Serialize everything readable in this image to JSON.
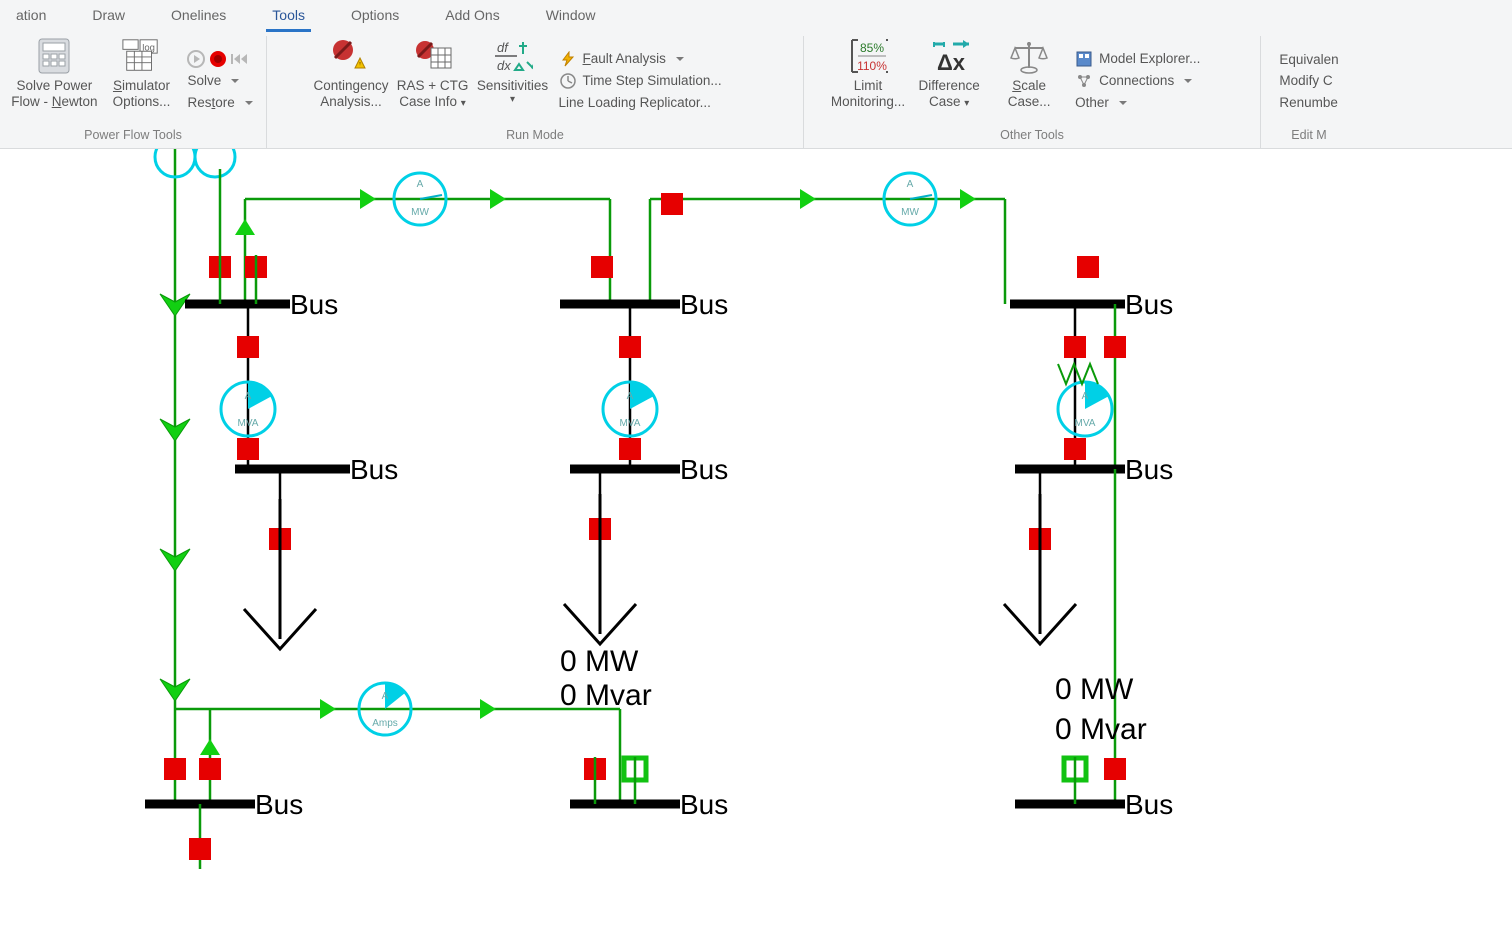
{
  "tabs": {
    "t0": "ation",
    "t1": "Draw",
    "t2": "Onelines",
    "t3": "Tools",
    "t4": "Options",
    "t5": "Add Ons",
    "t6": "Window"
  },
  "groups": {
    "pft": {
      "title": "Power Flow Tools",
      "solve_power_flow": "Solve Power\nFlow - Newton",
      "sim_options": "Simulator\nOptions...",
      "solve": "Solve",
      "restore": "Restore"
    },
    "run": {
      "title": "Run Mode",
      "contingency": "Contingency\nAnalysis...",
      "ras": "RAS + CTG\nCase Info",
      "sensitivities": "Sensitivities",
      "fault": "Fault Analysis",
      "tss": "Time Step Simulation...",
      "llr": "Line Loading Replicator..."
    },
    "other": {
      "title": "Other Tools",
      "limit": "Limit\nMonitoring...",
      "diff": "Difference\nCase",
      "scale": "Scale\nCase...",
      "model_explorer": "Model Explorer...",
      "connections": "Connections",
      "other": "Other"
    },
    "edit": {
      "title": "Edit M",
      "equiv": "Equivalen",
      "modify": "Modify C",
      "renumb": "Renumbe"
    },
    "limit_icon": {
      "top": "85%",
      "bottom": "110%"
    }
  },
  "diagram": {
    "bus_label": "Bus",
    "mw0": "0 MW",
    "mvar0": "0 Mvar",
    "pie_mw": "MW",
    "pie_mva": "MVA",
    "pie_amps": "Amps",
    "pie_a": "A"
  }
}
